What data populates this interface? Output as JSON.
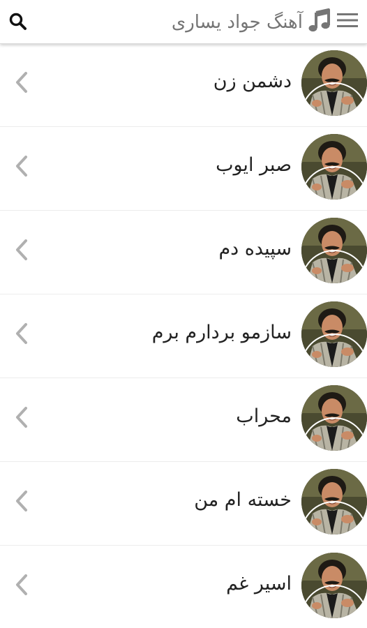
{
  "header": {
    "title": "آهنگ جواد یساری",
    "search_icon": "search-icon",
    "menu_icon": "hamburger-menu-icon",
    "music_icon": "music-note-icon",
    "title_color": "#757575"
  },
  "songs": [
    {
      "title": "دشمن زن"
    },
    {
      "title": "صبر ایوب"
    },
    {
      "title": "سپیده دم"
    },
    {
      "title": "سازمو بردارم برم"
    },
    {
      "title": "محراب"
    },
    {
      "title": "خسته ام من"
    },
    {
      "title": "اسیر غم"
    }
  ],
  "colors": {
    "background": "#ffffff",
    "divider": "#ececec",
    "chevron": "#b0b0b0",
    "text": "#222222"
  }
}
